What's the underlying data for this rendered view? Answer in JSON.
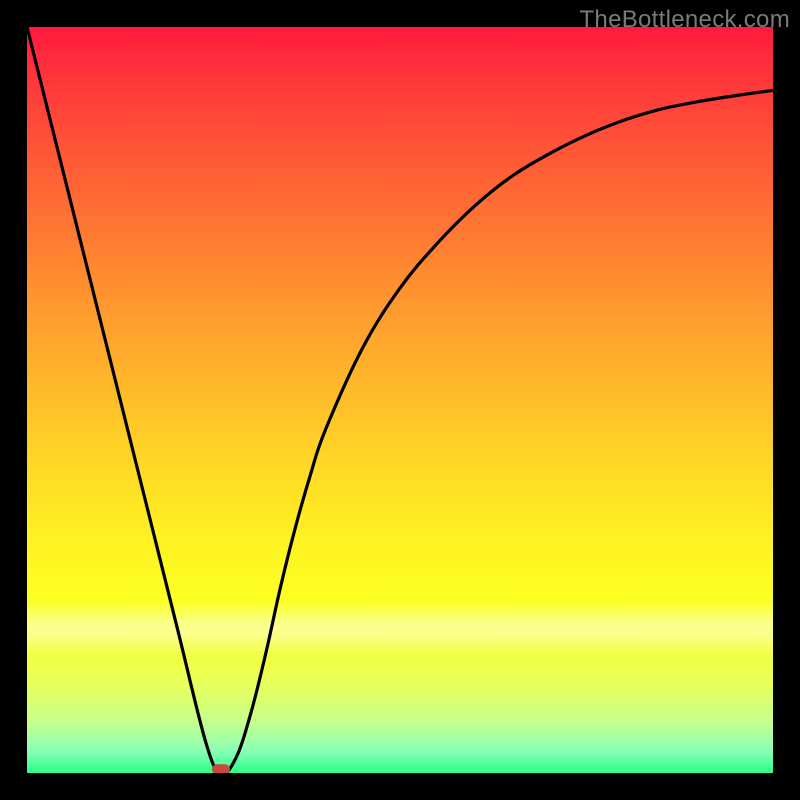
{
  "watermark": "TheBottleneck.com",
  "colors": {
    "background": "#000000",
    "gradient_top": "#ff1a3d",
    "gradient_mid": "#fff022",
    "gradient_bottom": "#2aff8a",
    "curve": "#000000",
    "marker": "#c94a3a",
    "watermark_text": "#7a7a7a"
  },
  "chart_data": {
    "type": "line",
    "title": "",
    "xlabel": "",
    "ylabel": "",
    "xlim": [
      0,
      100
    ],
    "ylim": [
      0,
      100
    ],
    "grid": false,
    "legend": false,
    "series": [
      {
        "name": "bottleneck-curve",
        "x": [
          0,
          5,
          10,
          15,
          20,
          24,
          26,
          28,
          30,
          32,
          34,
          36,
          38,
          40,
          45,
          50,
          55,
          60,
          65,
          70,
          75,
          80,
          85,
          90,
          95,
          100
        ],
        "y": [
          100,
          80,
          60,
          40,
          20,
          4,
          0,
          2,
          8,
          16,
          25,
          33,
          40,
          46,
          57,
          65,
          71,
          76,
          80,
          83,
          85.5,
          87.5,
          89,
          90,
          90.8,
          91.5
        ]
      }
    ],
    "annotations": [
      {
        "name": "optimum-marker",
        "x": 26,
        "y": 0.5,
        "shape": "pill",
        "color": "#c94a3a"
      }
    ]
  }
}
